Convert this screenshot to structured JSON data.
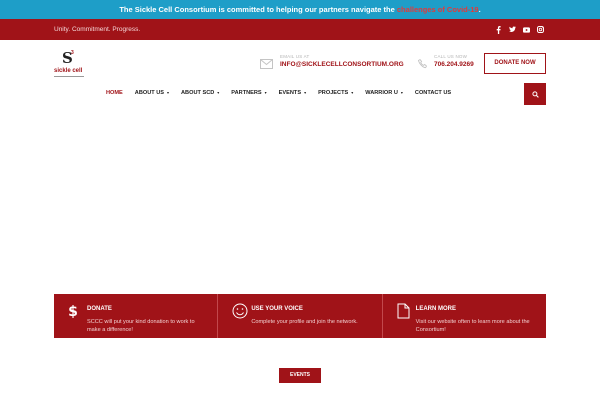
{
  "announcement": {
    "text": "The Sickle Cell Consortium is committed to helping our partners navigate the ",
    "link": "challenges of Covid-19",
    "suffix": "."
  },
  "topbar": {
    "tagline": "Unity. Commitment. Progress.",
    "social_icons": [
      "facebook-icon",
      "twitter-icon",
      "youtube-icon",
      "instagram-icon"
    ]
  },
  "logo": {
    "text": "sickle cell",
    "mark": "S",
    "superscript": "3"
  },
  "contact": {
    "email_label": "EMAIL US AT",
    "email": "INFO@SICKLECELLCONSORTIUM.ORG",
    "phone_label": "CALL US NOW",
    "phone": "706.204.9269"
  },
  "header": {
    "donate_label": "DONATE NOW"
  },
  "nav": {
    "items": [
      {
        "label": "HOME",
        "caret": ""
      },
      {
        "label": "ABOUT US",
        "caret": "▾"
      },
      {
        "label": "ABOUT SCD",
        "caret": "▾"
      },
      {
        "label": "PARTNERS",
        "caret": "▾"
      },
      {
        "label": "EVENTS",
        "caret": "▾"
      },
      {
        "label": "PROJECTS",
        "caret": "▾"
      },
      {
        "label": "WARRIOR U",
        "caret": "▾"
      },
      {
        "label": "CONTACT US",
        "caret": ""
      }
    ]
  },
  "cta": {
    "items": [
      {
        "icon": "dollar-icon",
        "title": "DONATE",
        "body": "SCCC will put your kind donation to work to make a difference!"
      },
      {
        "icon": "smiley-icon",
        "title": "USE YOUR VOICE",
        "body": "Complete your profile and join the network."
      },
      {
        "icon": "document-icon",
        "title": "LEARN MORE",
        "body": "Visit our website often to learn more about the Consortium!"
      }
    ]
  },
  "events_button": "EVENTS",
  "colors": {
    "brand_red": "#a01318",
    "announce_blue": "#1e9ec8",
    "highlight_red": "#e23a3a"
  }
}
